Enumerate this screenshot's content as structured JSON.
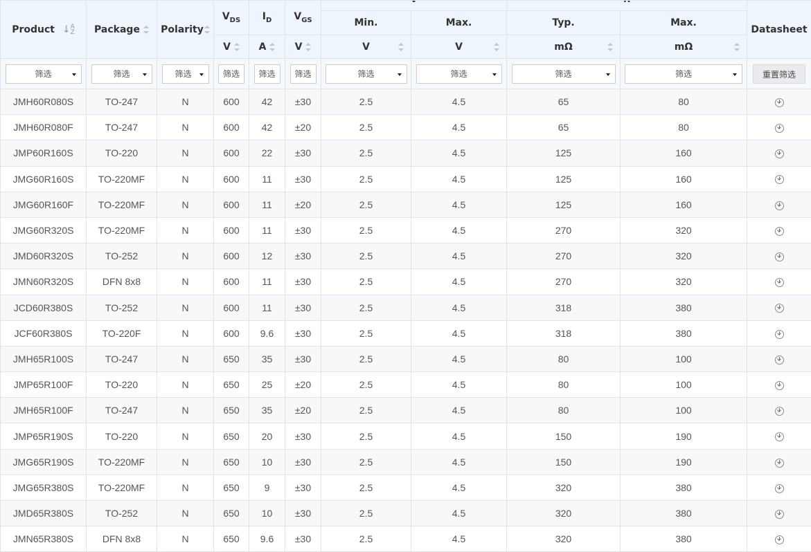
{
  "headers": {
    "product": "Product",
    "package": "Package",
    "polarity": "Polarity",
    "vds": {
      "main": "V",
      "sub": "DS"
    },
    "id": {
      "main": "I",
      "sub": "D"
    },
    "vgs": {
      "main": "V",
      "sub": "GS"
    },
    "vgs_th_group": "V",
    "rds_group": "R",
    "min": "Min.",
    "max1": "Max.",
    "typ": "Typ.",
    "max2": "Max.",
    "datasheet": "Datasheet",
    "az_top": "A",
    "az_bottom": "Z",
    "units": {
      "vds": "V",
      "id": "A",
      "vgs": "V",
      "vth_min": "V",
      "vth_max": "V",
      "rds_typ": "mΩ",
      "rds_max": "mΩ"
    }
  },
  "filters": {
    "placeholder": "筛选",
    "reset_label": "重置筛选"
  },
  "rows": [
    [
      "JMH60R080S",
      "TO-247",
      "N",
      "600",
      "42",
      "±30",
      "2.5",
      "4.5",
      "65",
      "80"
    ],
    [
      "JMH60R080F",
      "TO-247",
      "N",
      "600",
      "42",
      "±20",
      "2.5",
      "4.5",
      "65",
      "80"
    ],
    [
      "JMP60R160S",
      "TO-220",
      "N",
      "600",
      "22",
      "±30",
      "2.5",
      "4.5",
      "125",
      "160"
    ],
    [
      "JMG60R160S",
      "TO-220MF",
      "N",
      "600",
      "11",
      "±30",
      "2.5",
      "4.5",
      "125",
      "160"
    ],
    [
      "JMG60R160F",
      "TO-220MF",
      "N",
      "600",
      "11",
      "±20",
      "2.5",
      "4.5",
      "125",
      "160"
    ],
    [
      "JMG60R320S",
      "TO-220MF",
      "N",
      "600",
      "11",
      "±30",
      "2.5",
      "4.5",
      "270",
      "320"
    ],
    [
      "JMD60R320S",
      "TO-252",
      "N",
      "600",
      "12",
      "±30",
      "2.5",
      "4.5",
      "270",
      "320"
    ],
    [
      "JMN60R320S",
      "DFN 8x8",
      "N",
      "600",
      "11",
      "±30",
      "2.5",
      "4.5",
      "270",
      "320"
    ],
    [
      "JCD60R380S",
      "TO-252",
      "N",
      "600",
      "11",
      "±30",
      "2.5",
      "4.5",
      "318",
      "380"
    ],
    [
      "JCF60R380S",
      "TO-220F",
      "N",
      "600",
      "9.6",
      "±30",
      "2.5",
      "4.5",
      "318",
      "380"
    ],
    [
      "JMH65R100S",
      "TO-247",
      "N",
      "650",
      "35",
      "±30",
      "2.5",
      "4.5",
      "80",
      "100"
    ],
    [
      "JMP65R100F",
      "TO-220",
      "N",
      "650",
      "25",
      "±20",
      "2.5",
      "4.5",
      "80",
      "100"
    ],
    [
      "JMH65R100F",
      "TO-247",
      "N",
      "650",
      "35",
      "±20",
      "2.5",
      "4.5",
      "80",
      "100"
    ],
    [
      "JMP65R190S",
      "TO-220",
      "N",
      "650",
      "20",
      "±30",
      "2.5",
      "4.5",
      "150",
      "190"
    ],
    [
      "JMG65R190S",
      "TO-220MF",
      "N",
      "650",
      "10",
      "±30",
      "2.5",
      "4.5",
      "150",
      "190"
    ],
    [
      "JMG65R380S",
      "TO-220MF",
      "N",
      "650",
      "9",
      "±30",
      "2.5",
      "4.5",
      "320",
      "380"
    ],
    [
      "JMD65R380S",
      "TO-252",
      "N",
      "650",
      "10",
      "±30",
      "2.5",
      "4.5",
      "320",
      "380"
    ],
    [
      "JMN65R380S",
      "DFN 8x8",
      "N",
      "650",
      "9.6",
      "±30",
      "2.5",
      "4.5",
      "320",
      "380"
    ]
  ],
  "icons": {
    "sort": "sort-arrows-icon",
    "alpha_sort": "alpha-sort-icon",
    "dropdown": "caret-down-icon",
    "download": "download-icon"
  }
}
